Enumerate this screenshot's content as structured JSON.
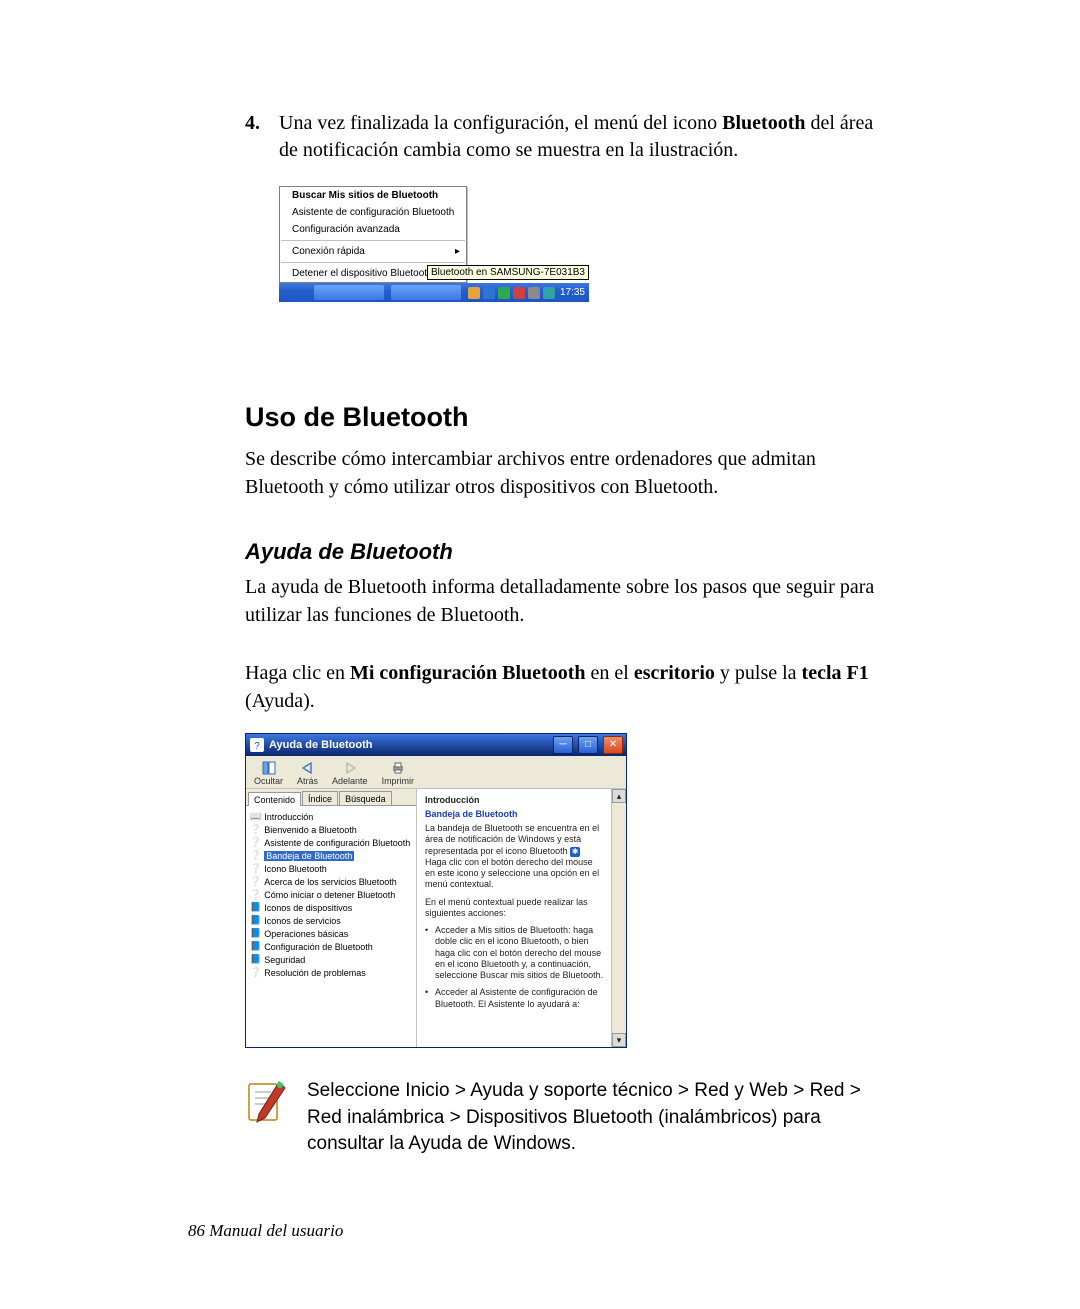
{
  "step4": {
    "num": "4.",
    "text_before_bold": "Una vez finalizada la configuración, el menú del icono ",
    "bold_word": "Bluetooth",
    "text_after_bold": " del área de notificación cambia como se muestra en la ilustración."
  },
  "context_menu": {
    "items": [
      {
        "label": "Buscar Mis sitios de Bluetooth",
        "bold": true
      },
      {
        "label": "Asistente de configuración Bluetooth"
      },
      {
        "label": "Configuración avanzada"
      }
    ],
    "quick_connect": "Conexión rápida",
    "stop_device": "Detener el dispositivo Bluetooth",
    "tooltip": "Bluetooth en SAMSUNG-7E031B3"
  },
  "taskbar": {
    "clock": "17:35",
    "tray_icons": [
      "#e7a23a",
      "#2f74d0",
      "#2fa84f",
      "#d04040",
      "#8a8a8a",
      "#2fa3a8"
    ]
  },
  "section_title": "Uso de Bluetooth",
  "section_para": "Se describe cómo intercambiar archivos entre ordenadores que admitan Bluetooth y cómo utilizar otros dispositivos con Bluetooth.",
  "subsection_title": "Ayuda de Bluetooth",
  "subsection_para": "La ayuda de Bluetooth informa detalladamente sobre los pasos que seguir para utilizar las funciones de Bluetooth.",
  "click_line": {
    "p1": "Haga clic en ",
    "b1": "Mi configuración Bluetooth",
    "p2": " en el ",
    "b2": "escritorio",
    "p3": " y pulse la ",
    "b3": "tecla F1",
    "p4": " (Ayuda)."
  },
  "help_window": {
    "title": "Ayuda de Bluetooth",
    "toolbar": [
      "Ocultar",
      "Atrás",
      "Adelante",
      "Imprimir"
    ],
    "tabs": [
      "Contenido",
      "Índice",
      "Búsqueda"
    ],
    "tree": {
      "root": "Introducción",
      "children": [
        "Bienvenido a Bluetooth",
        "Asistente de configuración Bluetooth",
        "Bandeja de Bluetooth",
        "Icono Bluetooth",
        "Acerca de los servicios Bluetooth",
        "Cómo iniciar o detener Bluetooth",
        "Iconos de dispositivos",
        "Iconos de servicios"
      ],
      "siblings": [
        "Operaciones básicas",
        "Configuración de Bluetooth",
        "Seguridad",
        "Resolución de problemas"
      ],
      "selected_index": 2
    },
    "content": {
      "h1": "Introducción",
      "h2": "Bandeja de Bluetooth",
      "p1": "La bandeja de Bluetooth se encuentra en el área de notificación de Windows y está representada por el icono Bluetooth",
      "p1b": "Haga clic con el botón derecho del mouse en este icono y seleccione una opción en el menú contextual.",
      "p2": "En el menú contextual puede realizar las siguientes acciones:",
      "li1": "Acceder a Mis sitios de Bluetooth: haga doble clic en el icono Bluetooth, o bien haga clic con el botón derecho del mouse en el icono Bluetooth y, a continuación, seleccione Buscar mis sitios de Bluetooth.",
      "li2": "Acceder al Asistente de configuración de Bluetooth. El Asistente lo ayudará a:"
    }
  },
  "note_text": "Seleccione Inicio > Ayuda y soporte técnico > Red y Web > Red > Red inalámbrica > Dispositivos Bluetooth (inalámbricos) para consultar la Ayuda de Windows.",
  "footer": {
    "page_num": "86",
    "label": "  Manual del usuario"
  }
}
